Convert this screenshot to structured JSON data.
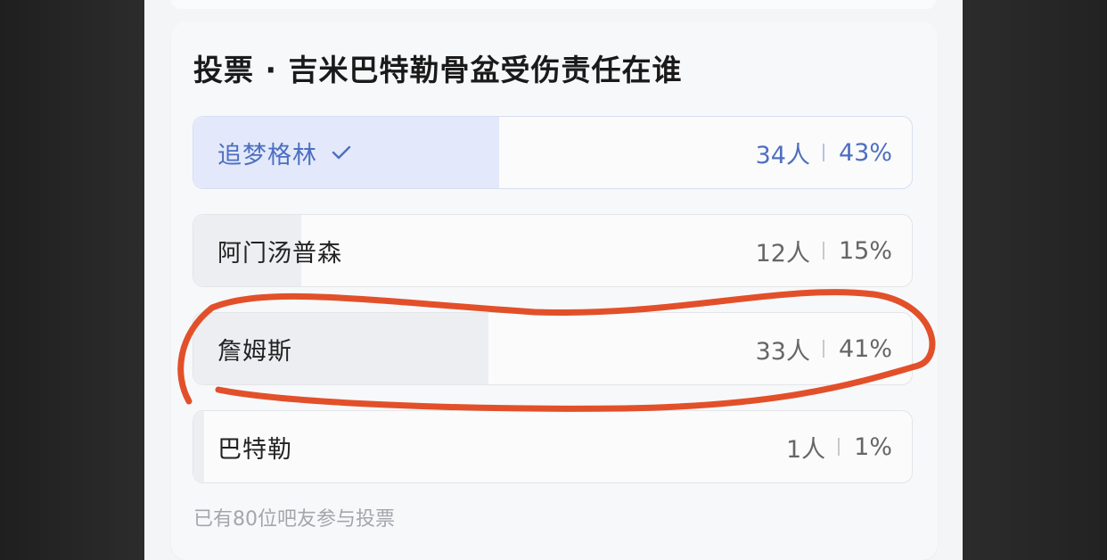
{
  "poll": {
    "title": "投票 · 吉米巴特勒骨盆受伤责任在谁",
    "options": [
      {
        "label": "追梦格林",
        "count": "34人",
        "percent": "43%",
        "fraction": 0.43,
        "selected": true
      },
      {
        "label": "阿门汤普森",
        "count": "12人",
        "percent": "15%",
        "fraction": 0.15,
        "selected": false
      },
      {
        "label": "詹姆斯",
        "count": "33人",
        "percent": "41%",
        "fraction": 0.41,
        "selected": false
      },
      {
        "label": "巴特勒",
        "count": "1人",
        "percent": "1%",
        "fraction": 0.01,
        "selected": false
      }
    ],
    "footer": "已有80位吧友参与投票"
  },
  "colors": {
    "selected_text": "#4d6fc0",
    "selected_fill": "#e3e9fb",
    "annotation_stroke": "#e0471f"
  },
  "icons": {
    "selected_mark": "check-icon"
  }
}
